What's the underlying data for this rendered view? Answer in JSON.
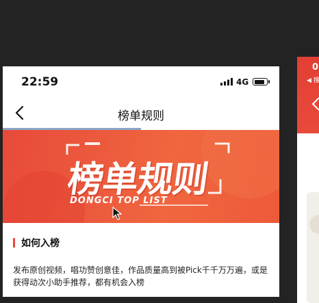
{
  "status_bar": {
    "time": "22:59",
    "network": "4G"
  },
  "nav": {
    "title": "榜单规则"
  },
  "page_load_progress": 0.5,
  "banner": {
    "title": "榜单规则",
    "subtitle": "DONGCI TOP LIST"
  },
  "section": {
    "heading": "如何入榜",
    "body": "发布原创视频，唱功赞创意佳，作品质量高到被Pick千千万万遍，或是获得动次小助手推荐，都有机会入榜"
  },
  "side_screen": {
    "time": "0",
    "back_label": "◀ 搜"
  },
  "colors": {
    "accent": "#e8453c",
    "banner": "#ec5a3d",
    "progress": "#8aa6c8"
  },
  "icons": {
    "back": "chevron-left-icon",
    "signal": "signal-icon",
    "battery": "battery-icon",
    "cursor": "mouse-cursor-icon"
  }
}
